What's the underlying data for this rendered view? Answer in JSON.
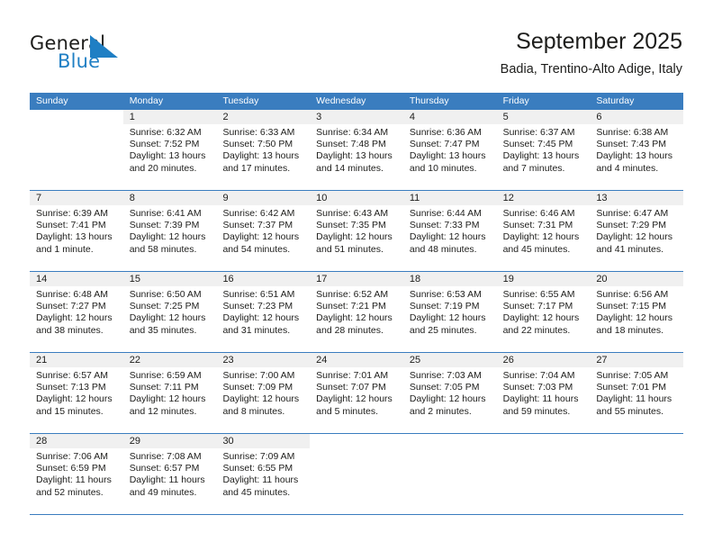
{
  "brand": {
    "name_top": "General",
    "name_bottom": "Blue",
    "logo_icon": "triangle-right-icon",
    "top_color": "#1d1d1b",
    "bottom_color": "#1f7fc4"
  },
  "header": {
    "title": "September 2025",
    "location": "Badia, Trentino-Alto Adige, Italy"
  },
  "calendar": {
    "header_bg": "#3a7dbf",
    "daynum_bg": "#f0f0f0",
    "weekdays": [
      "Sunday",
      "Monday",
      "Tuesday",
      "Wednesday",
      "Thursday",
      "Friday",
      "Saturday"
    ],
    "weeks": [
      [
        {
          "day": "",
          "sunrise": "",
          "sunset": "",
          "daylight1": "",
          "daylight2": "",
          "blank": true
        },
        {
          "day": "1",
          "sunrise": "Sunrise: 6:32 AM",
          "sunset": "Sunset: 7:52 PM",
          "daylight1": "Daylight: 13 hours",
          "daylight2": "and 20 minutes."
        },
        {
          "day": "2",
          "sunrise": "Sunrise: 6:33 AM",
          "sunset": "Sunset: 7:50 PM",
          "daylight1": "Daylight: 13 hours",
          "daylight2": "and 17 minutes."
        },
        {
          "day": "3",
          "sunrise": "Sunrise: 6:34 AM",
          "sunset": "Sunset: 7:48 PM",
          "daylight1": "Daylight: 13 hours",
          "daylight2": "and 14 minutes."
        },
        {
          "day": "4",
          "sunrise": "Sunrise: 6:36 AM",
          "sunset": "Sunset: 7:47 PM",
          "daylight1": "Daylight: 13 hours",
          "daylight2": "and 10 minutes."
        },
        {
          "day": "5",
          "sunrise": "Sunrise: 6:37 AM",
          "sunset": "Sunset: 7:45 PM",
          "daylight1": "Daylight: 13 hours",
          "daylight2": "and 7 minutes."
        },
        {
          "day": "6",
          "sunrise": "Sunrise: 6:38 AM",
          "sunset": "Sunset: 7:43 PM",
          "daylight1": "Daylight: 13 hours",
          "daylight2": "and 4 minutes."
        }
      ],
      [
        {
          "day": "7",
          "sunrise": "Sunrise: 6:39 AM",
          "sunset": "Sunset: 7:41 PM",
          "daylight1": "Daylight: 13 hours",
          "daylight2": "and 1 minute."
        },
        {
          "day": "8",
          "sunrise": "Sunrise: 6:41 AM",
          "sunset": "Sunset: 7:39 PM",
          "daylight1": "Daylight: 12 hours",
          "daylight2": "and 58 minutes."
        },
        {
          "day": "9",
          "sunrise": "Sunrise: 6:42 AM",
          "sunset": "Sunset: 7:37 PM",
          "daylight1": "Daylight: 12 hours",
          "daylight2": "and 54 minutes."
        },
        {
          "day": "10",
          "sunrise": "Sunrise: 6:43 AM",
          "sunset": "Sunset: 7:35 PM",
          "daylight1": "Daylight: 12 hours",
          "daylight2": "and 51 minutes."
        },
        {
          "day": "11",
          "sunrise": "Sunrise: 6:44 AM",
          "sunset": "Sunset: 7:33 PM",
          "daylight1": "Daylight: 12 hours",
          "daylight2": "and 48 minutes."
        },
        {
          "day": "12",
          "sunrise": "Sunrise: 6:46 AM",
          "sunset": "Sunset: 7:31 PM",
          "daylight1": "Daylight: 12 hours",
          "daylight2": "and 45 minutes."
        },
        {
          "day": "13",
          "sunrise": "Sunrise: 6:47 AM",
          "sunset": "Sunset: 7:29 PM",
          "daylight1": "Daylight: 12 hours",
          "daylight2": "and 41 minutes."
        }
      ],
      [
        {
          "day": "14",
          "sunrise": "Sunrise: 6:48 AM",
          "sunset": "Sunset: 7:27 PM",
          "daylight1": "Daylight: 12 hours",
          "daylight2": "and 38 minutes."
        },
        {
          "day": "15",
          "sunrise": "Sunrise: 6:50 AM",
          "sunset": "Sunset: 7:25 PM",
          "daylight1": "Daylight: 12 hours",
          "daylight2": "and 35 minutes."
        },
        {
          "day": "16",
          "sunrise": "Sunrise: 6:51 AM",
          "sunset": "Sunset: 7:23 PM",
          "daylight1": "Daylight: 12 hours",
          "daylight2": "and 31 minutes."
        },
        {
          "day": "17",
          "sunrise": "Sunrise: 6:52 AM",
          "sunset": "Sunset: 7:21 PM",
          "daylight1": "Daylight: 12 hours",
          "daylight2": "and 28 minutes."
        },
        {
          "day": "18",
          "sunrise": "Sunrise: 6:53 AM",
          "sunset": "Sunset: 7:19 PM",
          "daylight1": "Daylight: 12 hours",
          "daylight2": "and 25 minutes."
        },
        {
          "day": "19",
          "sunrise": "Sunrise: 6:55 AM",
          "sunset": "Sunset: 7:17 PM",
          "daylight1": "Daylight: 12 hours",
          "daylight2": "and 22 minutes."
        },
        {
          "day": "20",
          "sunrise": "Sunrise: 6:56 AM",
          "sunset": "Sunset: 7:15 PM",
          "daylight1": "Daylight: 12 hours",
          "daylight2": "and 18 minutes."
        }
      ],
      [
        {
          "day": "21",
          "sunrise": "Sunrise: 6:57 AM",
          "sunset": "Sunset: 7:13 PM",
          "daylight1": "Daylight: 12 hours",
          "daylight2": "and 15 minutes."
        },
        {
          "day": "22",
          "sunrise": "Sunrise: 6:59 AM",
          "sunset": "Sunset: 7:11 PM",
          "daylight1": "Daylight: 12 hours",
          "daylight2": "and 12 minutes."
        },
        {
          "day": "23",
          "sunrise": "Sunrise: 7:00 AM",
          "sunset": "Sunset: 7:09 PM",
          "daylight1": "Daylight: 12 hours",
          "daylight2": "and 8 minutes."
        },
        {
          "day": "24",
          "sunrise": "Sunrise: 7:01 AM",
          "sunset": "Sunset: 7:07 PM",
          "daylight1": "Daylight: 12 hours",
          "daylight2": "and 5 minutes."
        },
        {
          "day": "25",
          "sunrise": "Sunrise: 7:03 AM",
          "sunset": "Sunset: 7:05 PM",
          "daylight1": "Daylight: 12 hours",
          "daylight2": "and 2 minutes."
        },
        {
          "day": "26",
          "sunrise": "Sunrise: 7:04 AM",
          "sunset": "Sunset: 7:03 PM",
          "daylight1": "Daylight: 11 hours",
          "daylight2": "and 59 minutes."
        },
        {
          "day": "27",
          "sunrise": "Sunrise: 7:05 AM",
          "sunset": "Sunset: 7:01 PM",
          "daylight1": "Daylight: 11 hours",
          "daylight2": "and 55 minutes."
        }
      ],
      [
        {
          "day": "28",
          "sunrise": "Sunrise: 7:06 AM",
          "sunset": "Sunset: 6:59 PM",
          "daylight1": "Daylight: 11 hours",
          "daylight2": "and 52 minutes."
        },
        {
          "day": "29",
          "sunrise": "Sunrise: 7:08 AM",
          "sunset": "Sunset: 6:57 PM",
          "daylight1": "Daylight: 11 hours",
          "daylight2": "and 49 minutes."
        },
        {
          "day": "30",
          "sunrise": "Sunrise: 7:09 AM",
          "sunset": "Sunset: 6:55 PM",
          "daylight1": "Daylight: 11 hours",
          "daylight2": "and 45 minutes."
        },
        {
          "day": "",
          "sunrise": "",
          "sunset": "",
          "daylight1": "",
          "daylight2": "",
          "blank": true
        },
        {
          "day": "",
          "sunrise": "",
          "sunset": "",
          "daylight1": "",
          "daylight2": "",
          "blank": true
        },
        {
          "day": "",
          "sunrise": "",
          "sunset": "",
          "daylight1": "",
          "daylight2": "",
          "blank": true
        },
        {
          "day": "",
          "sunrise": "",
          "sunset": "",
          "daylight1": "",
          "daylight2": "",
          "blank": true
        }
      ]
    ]
  }
}
